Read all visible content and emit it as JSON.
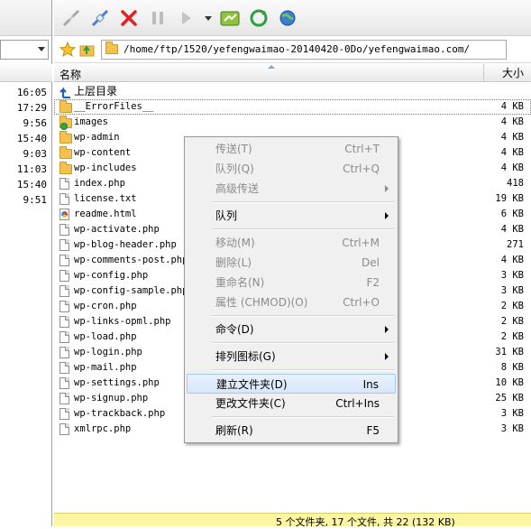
{
  "left_pane": {
    "times": [
      "16:05",
      "17:29",
      "9:56",
      "15:40",
      "9:03",
      "11:03",
      "15:40",
      "9:51"
    ]
  },
  "toolbar": {
    "icons": [
      "disconnect-icon",
      "connect-icon",
      "cancel-icon",
      "pause-icon",
      "queue-play-icon",
      "dropdown-icon",
      "site-manager-icon",
      "refresh-icon",
      "globe-icon"
    ]
  },
  "address": {
    "path": "/home/ftp/1520/yefengwaimao-20140420-0Do/yefengwaimao.com/"
  },
  "columns": {
    "name": "名称",
    "size": "大小"
  },
  "files": [
    {
      "name": "上层目录",
      "size": "",
      "type": "up"
    },
    {
      "name": "__ErrorFiles__",
      "size": "4 KB",
      "type": "folder"
    },
    {
      "name": "images",
      "size": "4 KB",
      "type": "folder-special"
    },
    {
      "name": "wp-admin",
      "size": "4 KB",
      "type": "folder"
    },
    {
      "name": "wp-content",
      "size": "4 KB",
      "type": "folder"
    },
    {
      "name": "wp-includes",
      "size": "4 KB",
      "type": "folder"
    },
    {
      "name": "index.php",
      "size": "418",
      "type": "file"
    },
    {
      "name": "license.txt",
      "size": "19 KB",
      "type": "file"
    },
    {
      "name": "readme.html",
      "size": "6 KB",
      "type": "html"
    },
    {
      "name": "wp-activate.php",
      "size": "4 KB",
      "type": "file"
    },
    {
      "name": "wp-blog-header.php",
      "size": "271",
      "type": "file"
    },
    {
      "name": "wp-comments-post.php",
      "size": "4 KB",
      "type": "file"
    },
    {
      "name": "wp-config.php",
      "size": "3 KB",
      "type": "file"
    },
    {
      "name": "wp-config-sample.php",
      "size": "3 KB",
      "type": "file"
    },
    {
      "name": "wp-cron.php",
      "size": "2 KB",
      "type": "file"
    },
    {
      "name": "wp-links-opml.php",
      "size": "2 KB",
      "type": "file"
    },
    {
      "name": "wp-load.php",
      "size": "2 KB",
      "type": "file"
    },
    {
      "name": "wp-login.php",
      "size": "31 KB",
      "type": "file"
    },
    {
      "name": "wp-mail.php",
      "size": "8 KB",
      "type": "file"
    },
    {
      "name": "wp-settings.php",
      "size": "10 KB",
      "type": "file"
    },
    {
      "name": "wp-signup.php",
      "size": "25 KB",
      "type": "file"
    },
    {
      "name": "wp-trackback.php",
      "size": "3 KB",
      "type": "file"
    },
    {
      "name": "xmlrpc.php",
      "size": "3 KB",
      "type": "file"
    }
  ],
  "context_menu": {
    "transfer": {
      "label": "传送(T)",
      "shortcut": "Ctrl+T"
    },
    "queue_add": {
      "label": "队列(Q)",
      "shortcut": "Ctrl+Q"
    },
    "advanced_transfer": {
      "label": "高级传送"
    },
    "queue": {
      "label": "队列"
    },
    "move": {
      "label": "移动(M)",
      "shortcut": "Ctrl+M"
    },
    "delete": {
      "label": "删除(L)",
      "shortcut": "Del"
    },
    "rename": {
      "label": "重命名(N)",
      "shortcut": "F2"
    },
    "chmod": {
      "label": "属性 (CHMOD)(O)",
      "shortcut": "Ctrl+O"
    },
    "command": {
      "label": "命令(D)"
    },
    "arrange_icons": {
      "label": "排列图标(G)"
    },
    "new_folder": {
      "label": "建立文件夹(D)",
      "shortcut": "Ins"
    },
    "change_folder": {
      "label": "更改文件夹(C)",
      "shortcut": "Ctrl+Ins"
    },
    "refresh": {
      "label": "刷新(R)",
      "shortcut": "F5"
    }
  },
  "status": {
    "text": "5 个文件夹, 17 个文件, 共 22 (132 KB)"
  },
  "colors": {
    "status_bg": "#fbf5a4",
    "menu_bg": "#f0f0f0",
    "highlight_border": "#a8c7ec",
    "folder": "#f3c14d"
  }
}
